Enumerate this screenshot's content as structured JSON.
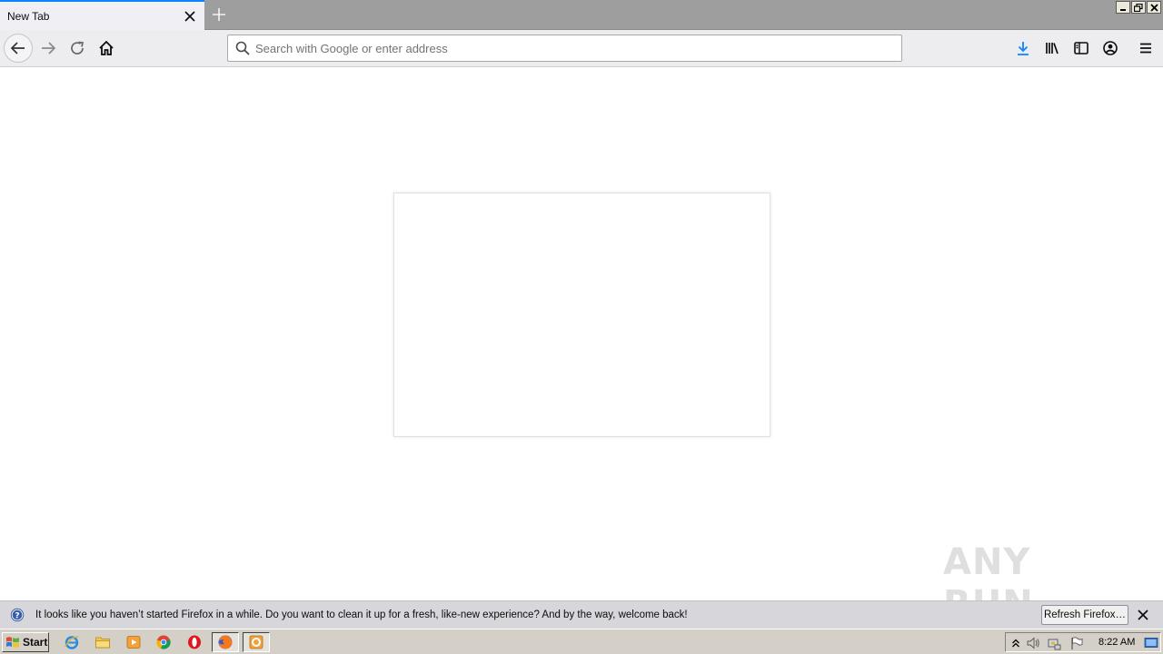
{
  "browser": {
    "active_tab": {
      "title": "New Tab"
    },
    "address_bar": {
      "placeholder": "Search with Google or enter address",
      "value": ""
    },
    "accent_color": "#0a84ff"
  },
  "toolbar_icons": [
    "back-icon",
    "forward-icon",
    "reload-icon",
    "home-icon",
    "download-icon",
    "library-icon",
    "sidebar-icon",
    "account-icon",
    "menu-icon"
  ],
  "notification": {
    "message": "It looks like you haven’t started Firefox in a while. Do you want to clean it up for a fresh, like-new experience? And by the way, welcome back!",
    "button_label": "Refresh Firefox…"
  },
  "watermark": {
    "text": "ANY RUN"
  },
  "taskbar": {
    "start_label": "Start",
    "apps": [
      "internet-explorer-icon",
      "file-explorer-icon",
      "media-player-icon",
      "chrome-icon",
      "opera-icon",
      "firefox-icon",
      "outlook-icon"
    ],
    "clock": "8:22 AM"
  }
}
